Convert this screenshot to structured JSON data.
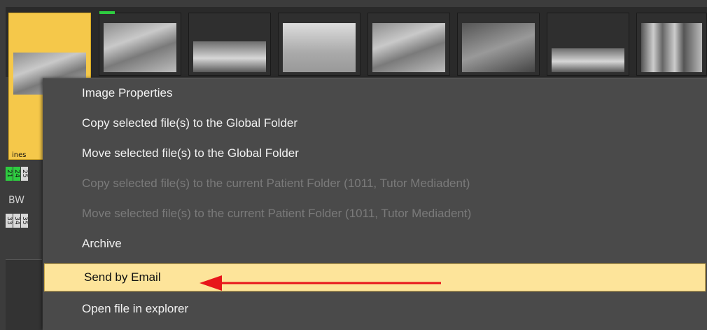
{
  "thumbnails": {
    "selected_caption": "ines"
  },
  "tooth_numbers": {
    "row1": [
      "21",
      "24",
      "25"
    ],
    "row2": [
      "33",
      "34",
      "35"
    ],
    "label": "BW"
  },
  "context_menu": {
    "items": [
      {
        "label": "Image Properties",
        "enabled": true
      },
      {
        "label": "Copy selected file(s) to the Global Folder",
        "enabled": true
      },
      {
        "label": "Move selected file(s) to the Global Folder",
        "enabled": true
      },
      {
        "label": "Copy selected file(s) to the current Patient Folder (1011, Tutor Mediadent)",
        "enabled": false
      },
      {
        "label": "Move selected file(s) to the current Patient Folder (1011, Tutor Mediadent)",
        "enabled": false
      },
      {
        "label": "Archive",
        "enabled": true
      },
      {
        "label": "Send by Email",
        "enabled": true,
        "highlighted": true
      },
      {
        "label": "Open file in explorer",
        "enabled": true
      }
    ]
  },
  "colors": {
    "highlight": "#fde49a",
    "selected_thumb": "#f5c84a",
    "annotation_arrow": "#e8151b",
    "marker_green": "#2ecc40"
  }
}
